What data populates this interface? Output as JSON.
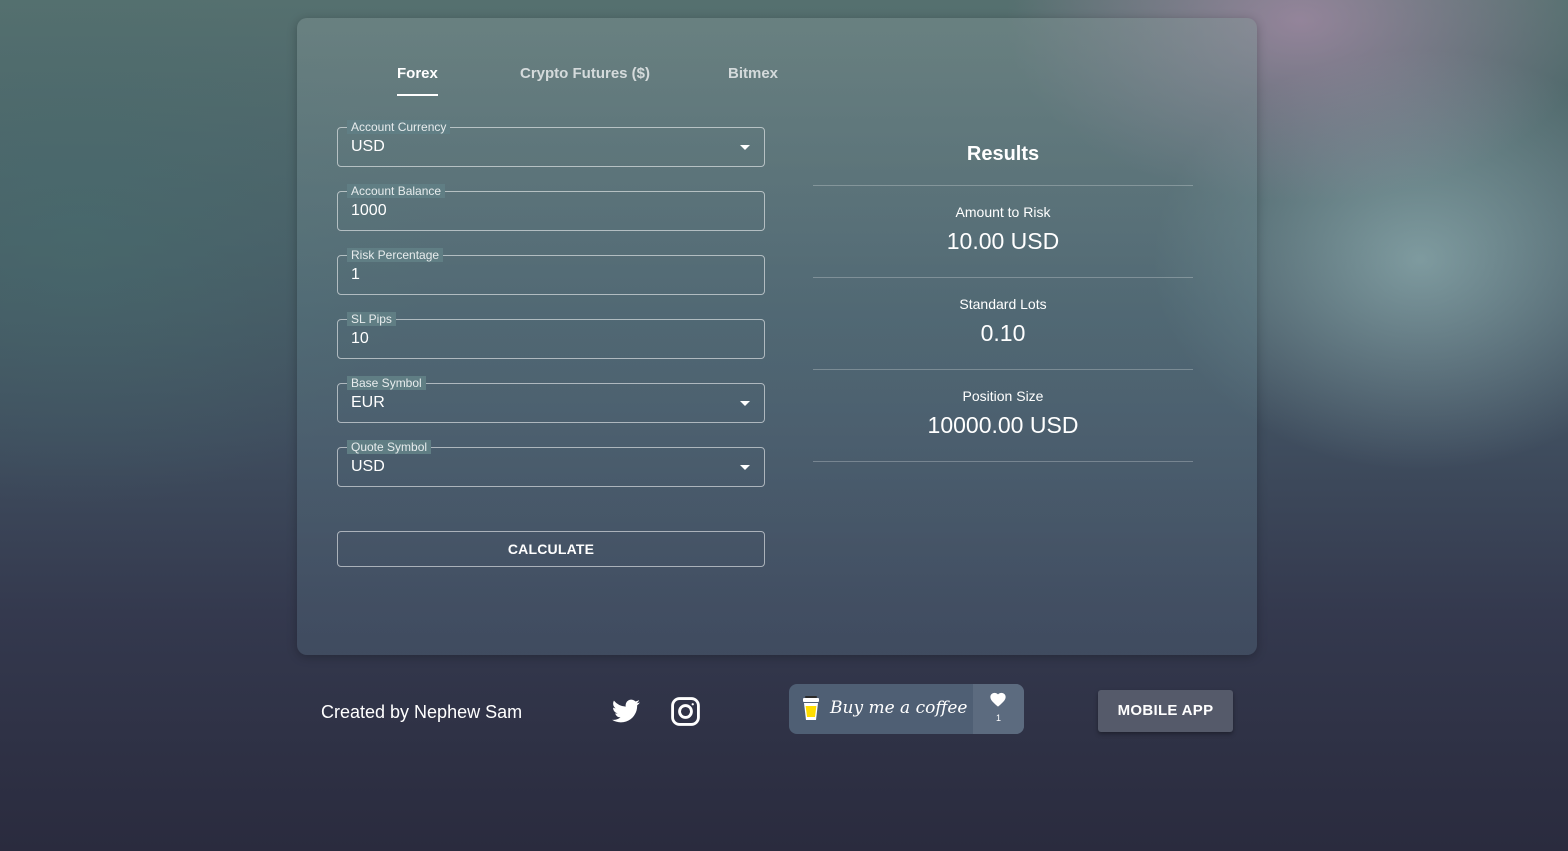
{
  "tabs": [
    "Forex",
    "Crypto Futures ($)",
    "Bitmex"
  ],
  "active_tab": "Forex",
  "form": {
    "account_currency": {
      "label": "Account Currency",
      "value": "USD"
    },
    "account_balance": {
      "label": "Account Balance",
      "value": "1000"
    },
    "risk_percentage": {
      "label": "Risk Percentage",
      "value": "1"
    },
    "sl_pips": {
      "label": "SL Pips",
      "value": "10"
    },
    "base_symbol": {
      "label": "Base Symbol",
      "value": "EUR"
    },
    "quote_symbol": {
      "label": "Quote Symbol",
      "value": "USD"
    },
    "calculate_label": "CALCULATE"
  },
  "results": {
    "title": "Results",
    "items": [
      {
        "label": "Amount to Risk",
        "value": "10.00 USD"
      },
      {
        "label": "Standard Lots",
        "value": "0.10"
      },
      {
        "label": "Position Size",
        "value": "10000.00 USD"
      }
    ]
  },
  "footer": {
    "credit": "Created by Nephew Sam",
    "icons": [
      "twitter-icon",
      "instagram-icon"
    ],
    "coffee_label": "Buy me a coffee",
    "coffee_count": "1",
    "mobile_app_label": "MOBILE APP"
  }
}
